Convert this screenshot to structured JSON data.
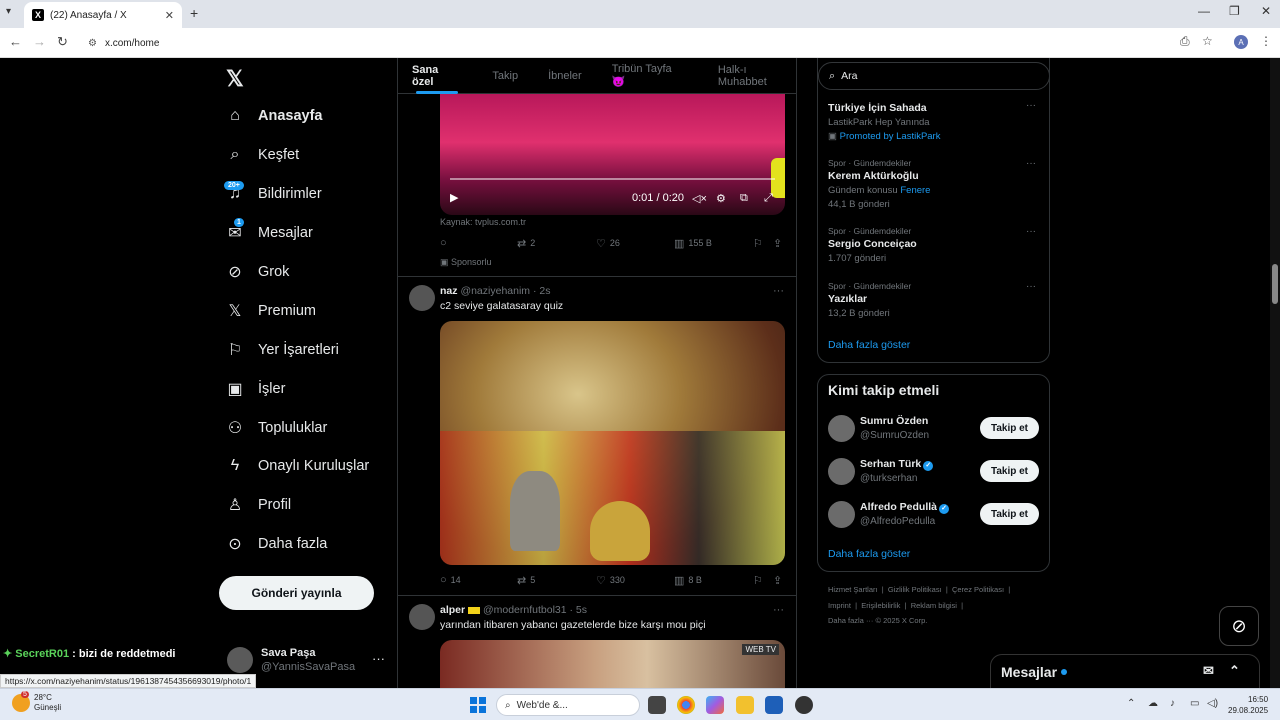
{
  "browser": {
    "tab_title": "(22) Anasayfa / X",
    "url": "x.com/home",
    "status_url": "https://x.com/naziyehanim/status/1961387454356693019/photo/1"
  },
  "sidebar": {
    "items": [
      {
        "label": "Anasayfa",
        "icon": "home-icon"
      },
      {
        "label": "Keşfet",
        "icon": "search-icon"
      },
      {
        "label": "Bildirimler",
        "icon": "bell-icon",
        "badge": "20+"
      },
      {
        "label": "Mesajlar",
        "icon": "mail-icon",
        "badge": "1"
      },
      {
        "label": "Grok",
        "icon": "grok-icon"
      },
      {
        "label": "Premium",
        "icon": "x-icon"
      },
      {
        "label": "Yer İşaretleri",
        "icon": "bookmark-icon"
      },
      {
        "label": "İşler",
        "icon": "briefcase-icon"
      },
      {
        "label": "Topluluklar",
        "icon": "people-icon"
      },
      {
        "label": "Onaylı Kuruluşlar",
        "icon": "lightning-icon"
      },
      {
        "label": "Profil",
        "icon": "person-icon"
      },
      {
        "label": "Daha fazla",
        "icon": "more-circle-icon"
      }
    ],
    "post_button": "Gönderi yayınla",
    "account": {
      "name": "Sava Paşa",
      "handle": "@YannisSavaPasa"
    }
  },
  "overlay": {
    "user": "SecretR01",
    "text": ": bizi de reddetmedi"
  },
  "feed": {
    "tabs": [
      "Sana özel",
      "Takip",
      "İbneler",
      "Tribün Tayfa 😈",
      "Halk-ı Muhabbet"
    ],
    "video": {
      "time": "0:01 / 0:20",
      "source": "Kaynak: tvplus.com.tr"
    },
    "ad_actions": {
      "reposts": "2",
      "likes": "26",
      "views": "155 B"
    },
    "sponsored": "Sponsorlu",
    "tweet1": {
      "name": "naz",
      "meta": "@naziyehanim · 2s",
      "text": "c2 seviye galatasaray quiz",
      "replies": "14",
      "reposts": "5",
      "likes": "330",
      "views": "8 B"
    },
    "tweet2": {
      "name": "alper",
      "meta": "@modernfutbol31 · 5s",
      "text": "yarından itibaren yabancı gazetelerde bize karşı mou piçi"
    }
  },
  "right": {
    "search_placeholder": "Ara",
    "trends": [
      {
        "meta": "",
        "name": "Türkiye İçin Sahada",
        "sub": "LastikPark Hep Yanında",
        "sub2": "Promoted by LastikPark"
      },
      {
        "meta": "Spor · Gündemdekiler",
        "name": "Kerem Aktürkoğlu",
        "sub": "Gündem konusu",
        "link": "Fenere",
        "sub2": "44,1 B gönderi"
      },
      {
        "meta": "Spor · Gündemdekiler",
        "name": "Sergio Conceiçao",
        "sub": "1.707 gönderi"
      },
      {
        "meta": "Spor · Gündemdekiler",
        "name": "Yazıklar",
        "sub": "13,2 B gönderi"
      }
    ],
    "show_more": "Daha fazla göster",
    "wtf_title": "Kimi takip etmeli",
    "follow_label": "Takip et",
    "who_to_follow": [
      {
        "name": "Sumru Özden",
        "handle": "@SumruOzden",
        "verified": false
      },
      {
        "name": "Serhan Türk",
        "handle": "@turkserhan",
        "verified": true
      },
      {
        "name": "Alfredo Pedullà",
        "handle": "@AlfredoPedulla",
        "verified": true
      }
    ],
    "footer": {
      "l1": [
        "Hizmet Şartları",
        "Gizlilik Politikası",
        "Çerez Politikası"
      ],
      "l2": [
        "Imprint",
        "Erişilebilirlik",
        "Reklam bilgisi"
      ],
      "l3": "Daha fazla ··· © 2025 X Corp."
    },
    "messages": "Mesajlar"
  },
  "taskbar": {
    "temp": "28°C",
    "weather": "Güneşli",
    "weather_count": "5",
    "search": "Web'de &...",
    "time": "16:50",
    "date": "29.08.2025"
  }
}
